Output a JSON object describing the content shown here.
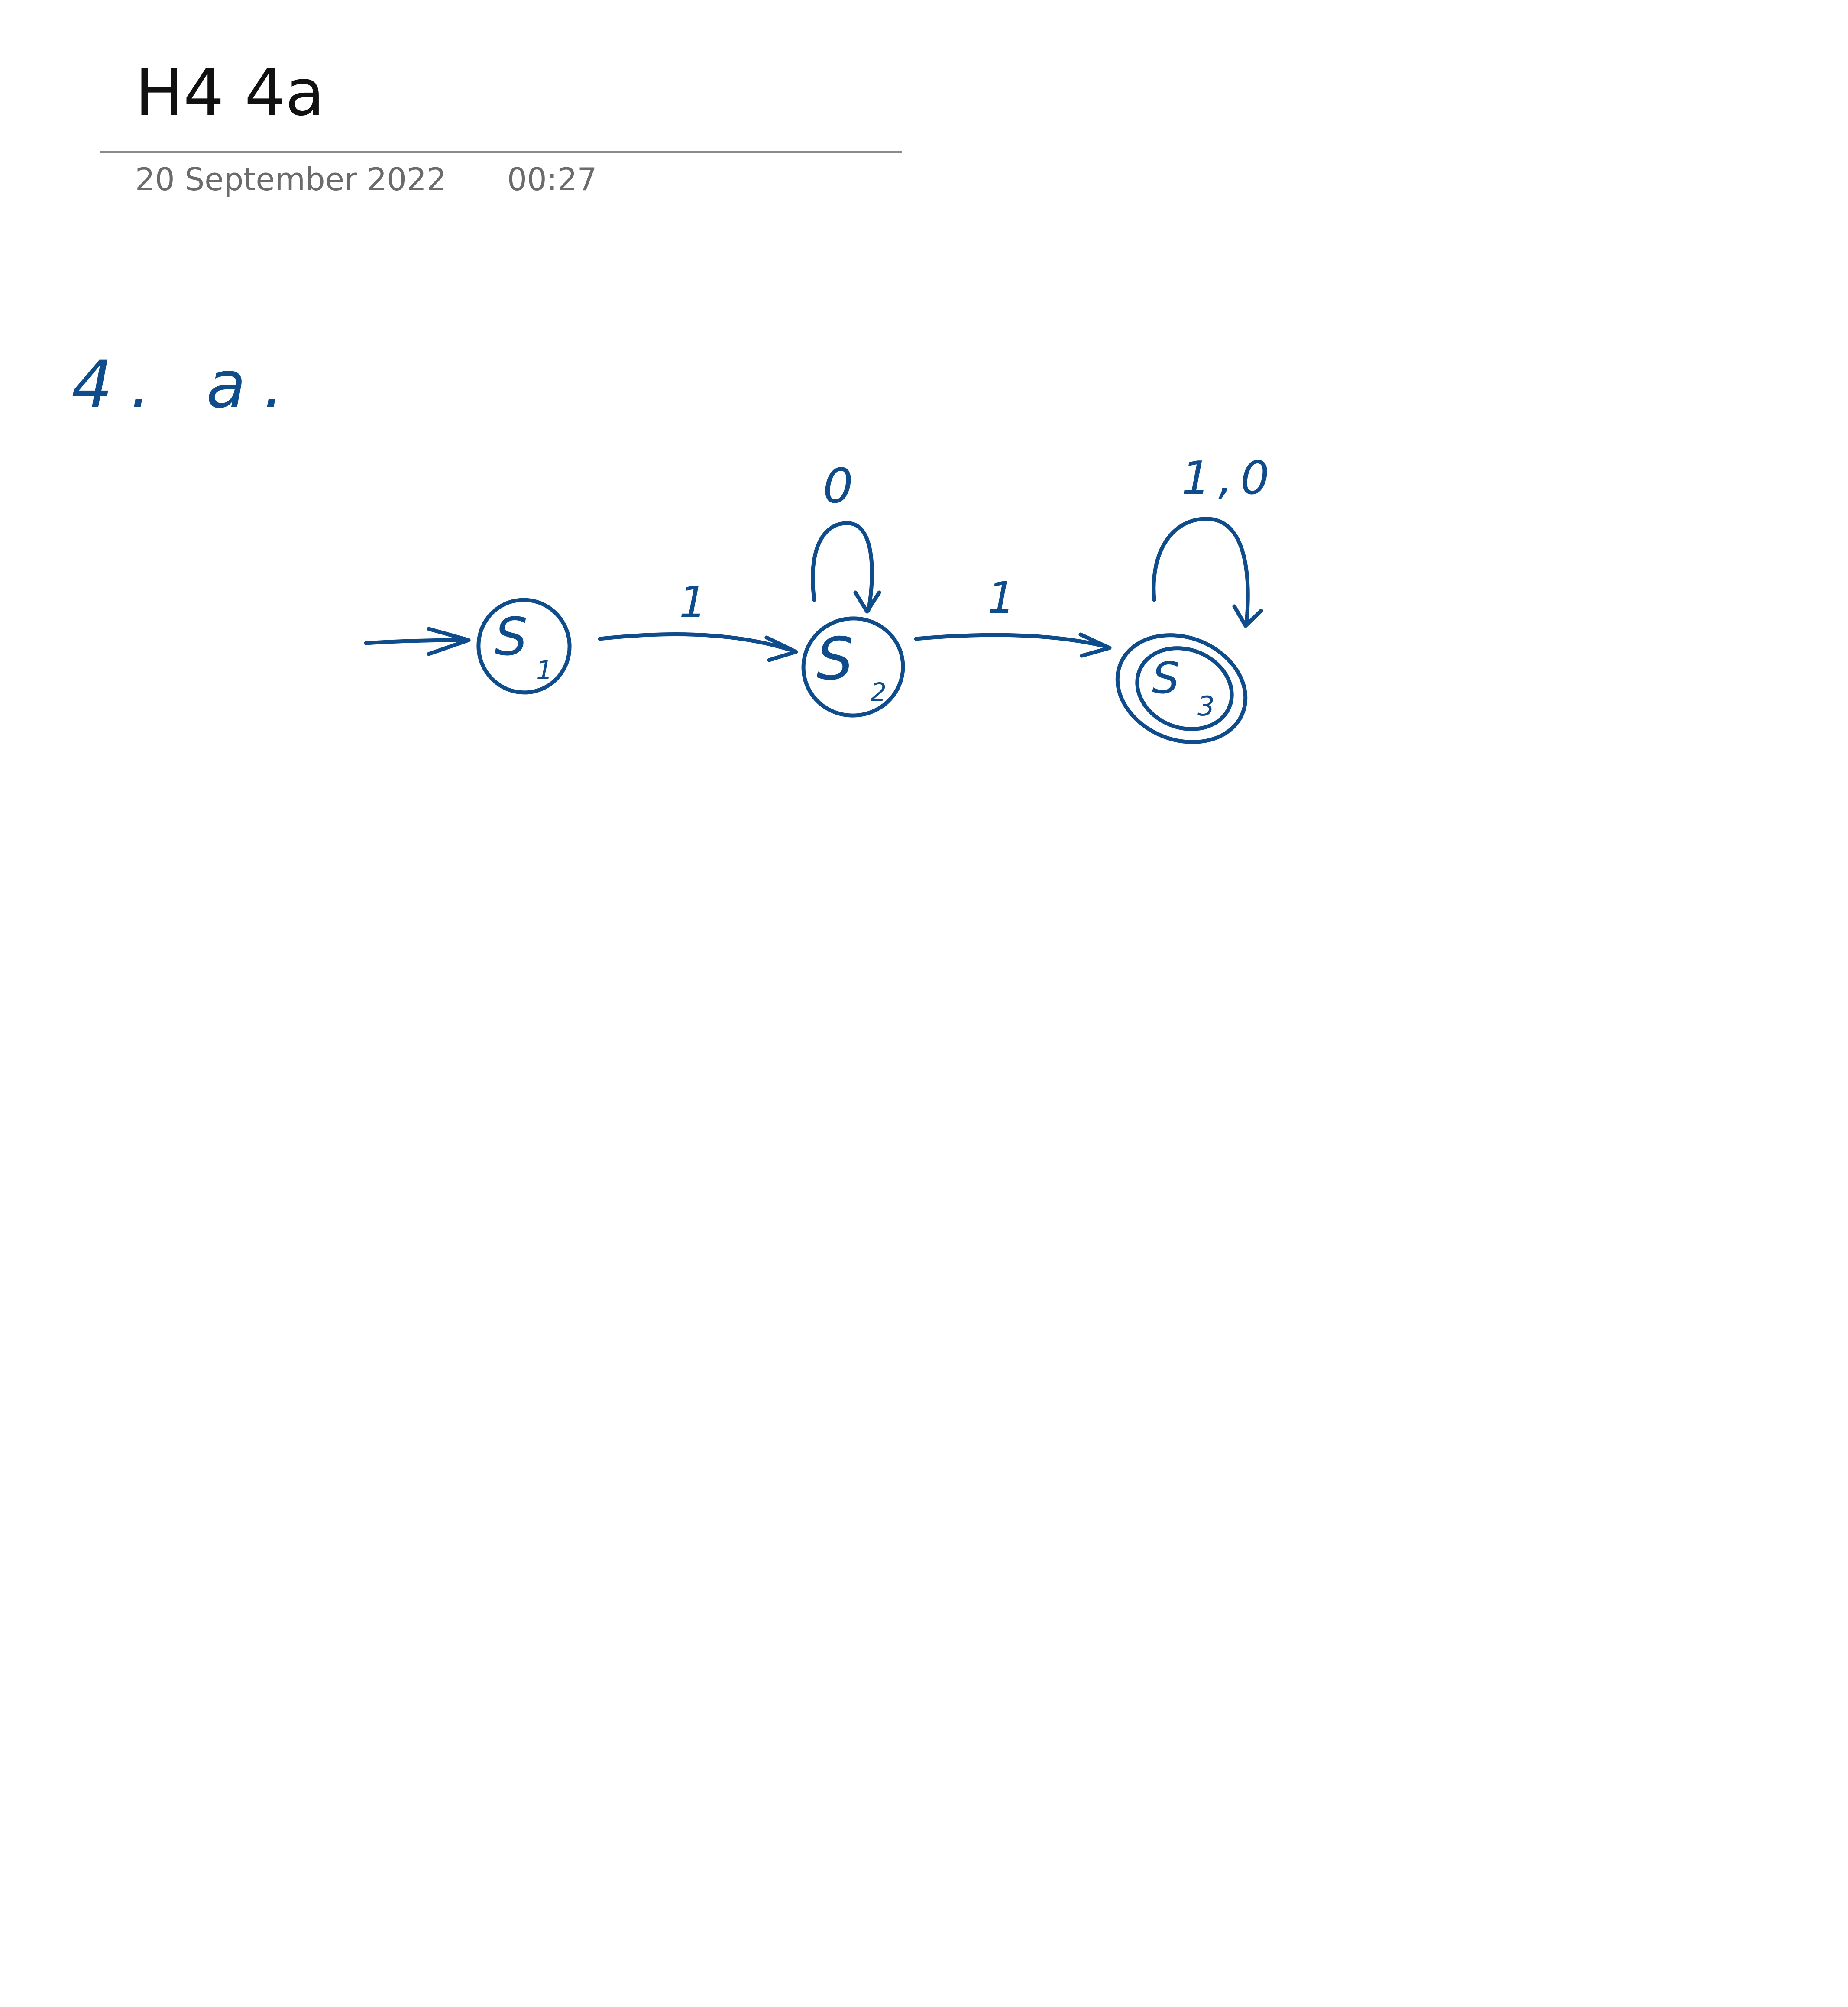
{
  "page": {
    "title": "H4 4a",
    "date": "20 September 2022",
    "time": "00:27"
  },
  "ink": {
    "color": "#0f4c8c",
    "section_label": "4. a.",
    "automaton": {
      "states": [
        {
          "id": "s1",
          "label": "S",
          "subscript": "1",
          "start": true,
          "accepting": false
        },
        {
          "id": "s2",
          "label": "S",
          "subscript": "2",
          "start": false,
          "accepting": false
        },
        {
          "id": "s3",
          "label": "S",
          "subscript": "3",
          "start": false,
          "accepting": true
        }
      ],
      "transitions": [
        {
          "from": "s1",
          "to": "s2",
          "label": "1"
        },
        {
          "from": "s2",
          "to": "s2",
          "label": "0"
        },
        {
          "from": "s2",
          "to": "s3",
          "label": "1"
        },
        {
          "from": "s3",
          "to": "s3",
          "label": "1,0"
        }
      ]
    }
  }
}
